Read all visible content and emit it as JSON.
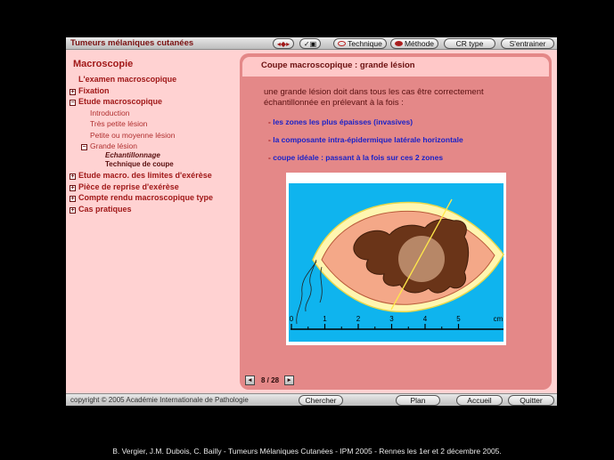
{
  "window": {
    "title": "Tumeurs mélaniques cutanées"
  },
  "toolbar": {
    "nav_arrows_glyph": "◂◆▸",
    "tools_glyph": "✓▣",
    "technique": "Technique",
    "methode": "Méthode",
    "cr_type": "CR type",
    "sentrainer": "S'entrainer"
  },
  "nav": {
    "heading": "Macroscopie",
    "items": [
      {
        "label": "L'examen macroscopique",
        "toggle": ""
      },
      {
        "label": "Fixation",
        "toggle": "+"
      },
      {
        "label": "Etude macroscopique",
        "toggle": "−"
      },
      {
        "label": "Introduction"
      },
      {
        "label": "Très petite lésion"
      },
      {
        "label": "Petite ou moyenne lésion"
      },
      {
        "label": "Grande lésion",
        "toggle": "−"
      },
      {
        "label": "Echantillonnage"
      },
      {
        "label": "Technique de coupe"
      },
      {
        "label": "Etude macro. des limites d'exérèse",
        "toggle": "+"
      },
      {
        "label": "Pièce de reprise d'exérèse",
        "toggle": "+"
      },
      {
        "label": "Compte rendu macroscopique type",
        "toggle": "+"
      },
      {
        "label": "Cas pratiques",
        "toggle": "+"
      }
    ]
  },
  "content": {
    "title": "Coupe macroscopique : grande lésion",
    "intro": "une grande lésion doit dans tous les cas être correctement échantillonnée en prélevant à la fois :",
    "bullets": [
      "les zones les plus épaisses (invasives)",
      "la composante intra-épidermique latérale horizontale",
      "coupe idéale : passant à la fois sur ces 2 zones"
    ],
    "bullet_dash": "-",
    "ruler": {
      "labels": [
        "0",
        "1",
        "2",
        "3",
        "4",
        "5",
        "cm"
      ]
    }
  },
  "pager": {
    "prev": "◂",
    "next": "▸",
    "page": "8 / 28"
  },
  "footer": {
    "copyright": "copyright © 2005 Académie Internationale de Pathologie",
    "chercher": "Chercher",
    "plan": "Plan",
    "accueil": "Accueil",
    "quitter": "Quitter"
  },
  "caption": "B. Vergier, J.M. Dubois, C. Bailly - Tumeurs Mélaniques Cutanées - IPM 2005 - Rennes les 1er et 2 décembre 2005.",
  "colors": {
    "accent": "#a01818",
    "panel": "#e48888",
    "sky": "#0fb4ee",
    "skin": "#f4a888",
    "lesion": "#6a3418",
    "bullet_text": "#1a22c8"
  }
}
